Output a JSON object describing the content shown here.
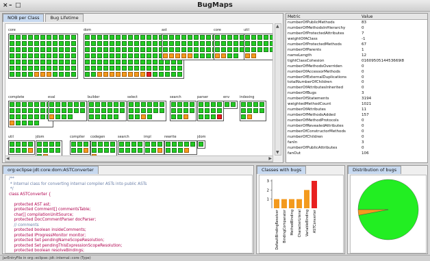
{
  "window": {
    "title": "BugMaps",
    "controls": [
      "×",
      "–",
      "□"
    ]
  },
  "viz_panel": {
    "tabs": [
      {
        "label": "NOB per Class",
        "active": true
      },
      {
        "label": "Bug Lifetime",
        "active": false
      }
    ],
    "packages": [
      {
        "label": "core",
        "rows": 7,
        "cols": 11,
        "count": 77,
        "orange": [
          70,
          71,
          72
        ]
      },
      {
        "label": "dom",
        "rows": 7,
        "cols": 16,
        "count": 112,
        "orange": [
          98,
          99,
          100,
          101,
          102,
          103,
          104,
          105
        ],
        "red": [
          106
        ]
      },
      {
        "label": "ast",
        "rows": 4,
        "cols": 11,
        "count": 44,
        "orange": [
          33,
          34,
          35,
          36,
          37
        ]
      },
      {
        "label": "core",
        "rows": 4,
        "cols": 5,
        "count": 19,
        "orange": [
          15,
          16
        ]
      },
      {
        "label": "util",
        "rows": 4,
        "cols": 6,
        "count": 20,
        "orange": [
          18,
          19
        ]
      },
      {
        "label": "complete",
        "rows": 4,
        "cols": 7,
        "count": 26,
        "orange": [
          21
        ]
      },
      {
        "label": "eval",
        "rows": 3,
        "cols": 6,
        "count": 16,
        "orange": [
          12
        ]
      },
      {
        "label": "builder",
        "rows": 3,
        "cols": 6,
        "count": 17,
        "orange": []
      },
      {
        "label": "select",
        "rows": 3,
        "cols": 6,
        "count": 16,
        "orange": [
          14
        ]
      },
      {
        "label": "search",
        "rows": 3,
        "cols": 4,
        "count": 11,
        "orange": [
          10
        ]
      },
      {
        "label": "parser",
        "rows": 3,
        "cols": 4,
        "count": 12,
        "orange": [],
        "red": [
          11
        ]
      },
      {
        "label": "env",
        "rows": 1,
        "cols": 2,
        "count": 2,
        "orange": []
      },
      {
        "label": "indexing",
        "rows": 3,
        "cols": 4,
        "count": 10,
        "orange": [
          9
        ]
      },
      {
        "label": "util",
        "rows": 2,
        "cols": 4,
        "count": 8,
        "orange": [
          7
        ]
      },
      {
        "label": "jdom",
        "rows": 3,
        "cols": 4,
        "count": 10,
        "orange": [
          9
        ]
      },
      {
        "label": "compiler",
        "rows": 2,
        "cols": 3,
        "count": 6,
        "orange": [
          5
        ]
      },
      {
        "label": "codegen",
        "rows": 3,
        "cols": 4,
        "count": 9,
        "orange": [
          8
        ]
      },
      {
        "label": "search",
        "rows": 2,
        "cols": 4,
        "count": 8,
        "orange": []
      },
      {
        "label": "impl",
        "rows": 2,
        "cols": 3,
        "count": 6,
        "orange": [
          5
        ]
      },
      {
        "label": "rewrite",
        "rows": 2,
        "cols": 5,
        "count": 9,
        "orange": [
          8
        ]
      },
      {
        "label": "jdom",
        "rows": 1,
        "cols": 1,
        "count": 1,
        "orange": []
      }
    ]
  },
  "metrics": {
    "headers": {
      "metric": "Metric",
      "value": "Value"
    },
    "rows": [
      {
        "k": "numberOfPublicMethods",
        "v": "83"
      },
      {
        "k": "numberOfMethodsInHierarchy",
        "v": "0"
      },
      {
        "k": "numberOfProtectedAttributes",
        "v": "7"
      },
      {
        "k": "weightOfAClass",
        "v": "-1"
      },
      {
        "k": "numberOfProtectedMethods",
        "v": "67"
      },
      {
        "k": "numberOfParents",
        "v": "1"
      },
      {
        "k": "nameLength",
        "v": "12"
      },
      {
        "k": "tightClassCohesion",
        "v": "0160950514453669l8"
      },
      {
        "k": "numberOfMethodsOverriden",
        "v": "0"
      },
      {
        "k": "numberOfAccessorMethods",
        "v": "0"
      },
      {
        "k": "numberOfExternalDuplications",
        "v": "0"
      },
      {
        "k": "totalNumberOfChildren",
        "v": "0"
      },
      {
        "k": "numberOfAttributesInherited",
        "v": "0"
      },
      {
        "k": "numberOfBugs",
        "v": "3"
      },
      {
        "k": "numberOfStatements",
        "v": "3194"
      },
      {
        "k": "weightedMethodCount",
        "v": "1021"
      },
      {
        "k": "numberOfAttributes",
        "v": "11"
      },
      {
        "k": "numberOfMethodsAdded",
        "v": "157"
      },
      {
        "k": "numberOfMethodProtocols",
        "v": "0"
      },
      {
        "k": "numberOfRevealedAttributes",
        "v": "0"
      },
      {
        "k": "numberOfConstructorMethods",
        "v": "0"
      },
      {
        "k": "numberOfChildren",
        "v": "0"
      },
      {
        "k": "fanIn",
        "v": "3"
      },
      {
        "k": "numberOfPublicAttributes",
        "v": "0"
      },
      {
        "k": "fanOut",
        "v": "106"
      }
    ]
  },
  "code_panel": {
    "tab": "org:eclipse:jdt:core:dom:ASTConverter",
    "lines": [
      {
        "t": "/**",
        "c": "cm"
      },
      {
        "t": " * Internal class for converting internal compiler ASTs into public ASTs",
        "c": "cm"
      },
      {
        "t": " */",
        "c": "cm"
      },
      {
        "t": "class ASTConverter {",
        "c": "kw"
      },
      {
        "t": "",
        "c": ""
      },
      {
        "t": "    protected AST ast;",
        "c": "kw"
      },
      {
        "t": "    protected Comment[] commentsTable;",
        "c": "kw"
      },
      {
        "t": "    char[] compilationUnitSource;",
        "c": "kw"
      },
      {
        "t": "    protected DocCommentParser docParser;",
        "c": "kw"
      },
      {
        "t": "    // comments",
        "c": "cm"
      },
      {
        "t": "    protected boolean insideComments;",
        "c": "kw"
      },
      {
        "t": "    protected IProgressMonitor monitor;",
        "c": "kw"
      },
      {
        "t": "    protected Set pendingNameScopeResolution;",
        "c": "kw"
      },
      {
        "t": "    protected Set pendingThisExpressionScopeResolution;",
        "c": "kw"
      },
      {
        "t": "    protected boolean resolveBindings;",
        "c": "kw"
      }
    ]
  },
  "bar_panel": {
    "tab": "Classes with bugs"
  },
  "pie_panel": {
    "tab": "Distribution of bugs"
  },
  "chart_data": [
    {
      "type": "bar",
      "categories": [
        "DefaultBindingResolver",
        "BindingComparator",
        "MethodBinding",
        "CharacterLiteral",
        "VariableBinding",
        "ASTConverter"
      ],
      "values": [
        1,
        1,
        1,
        1,
        2,
        3
      ],
      "ylim": [
        0,
        3
      ],
      "yticks": [
        "1",
        "2",
        "3"
      ],
      "colors": [
        "#f39a1e",
        "#f39a1e",
        "#f39a1e",
        "#f39a1e",
        "#f39a1e",
        "#e82020"
      ]
    },
    {
      "type": "pie",
      "values": [
        97,
        3
      ],
      "colors": [
        "#22ee22",
        "#f39a1e"
      ]
    }
  ],
  "status": {
    "text": "JarEntryFile in org::eclipse::jdt::internal::core (Type)"
  }
}
